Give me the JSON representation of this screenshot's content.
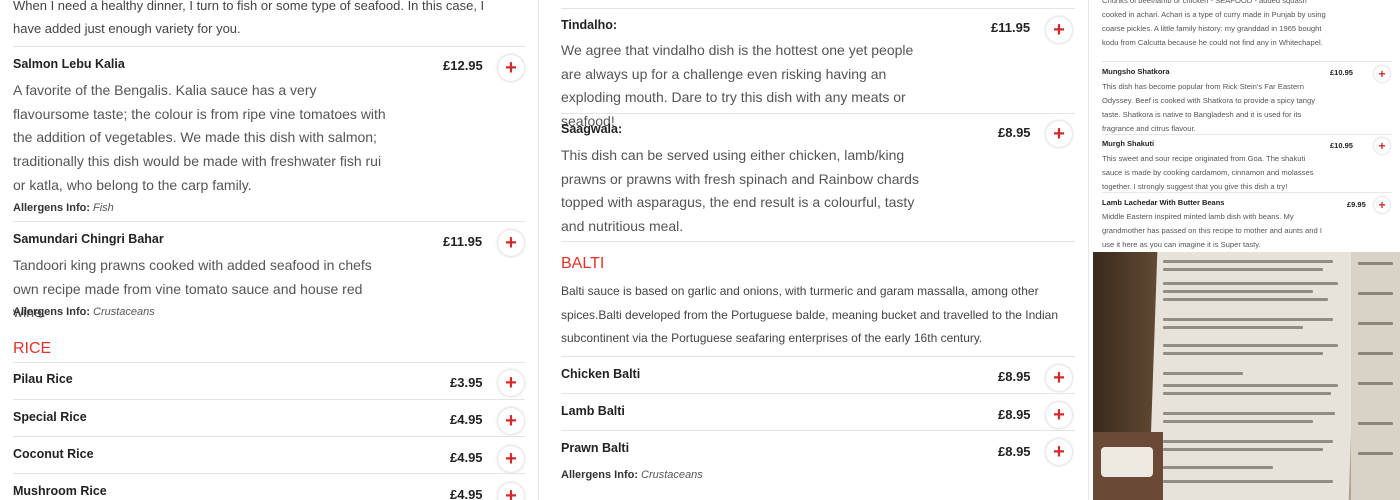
{
  "col1": {
    "intro": "When I need a healthy dinner, I turn to fish or some type of seafood. In this case, I have added just enough variety for you.",
    "items": [
      {
        "name": "Salmon Lebu Kalia",
        "price": "£12.95",
        "desc": "A favorite of the Bengalis. Kalia sauce has a very flavoursome taste; the colour is from ripe vine tomatoes with the addition of vegetables. We made this dish with salmon; traditionally this dish would be made with freshwater fish rui or katla, who belong to the carp family.",
        "allergen_label": "Allergens Info:",
        "allergen": "Fish"
      },
      {
        "name": "Samundari Chingri Bahar",
        "price": "£11.95",
        "desc": "Tandoori king prawns cooked with added seafood in chefs own recipe made from vine tomato sauce and house red wine.",
        "allergen_label": "Allergens Info:",
        "allergen": "Crustaceans"
      }
    ],
    "rice_title": "RICE",
    "rice": [
      {
        "name": "Pilau Rice",
        "price": "£3.95"
      },
      {
        "name": "Special Rice",
        "price": "£4.95"
      },
      {
        "name": "Coconut Rice",
        "price": "£4.95"
      },
      {
        "name": "Mushroom Rice",
        "price": "£4.95"
      }
    ],
    "add_symbol": "+"
  },
  "col2": {
    "items": [
      {
        "name": "Tindalho:",
        "price": "£11.95",
        "desc": "We agree that vindalho dish is the hottest one yet people are always up for a challenge even risking having an exploding mouth. Dare to try this dish with any meats or seafood!"
      },
      {
        "name": "Saagwala:",
        "price": "£8.95",
        "desc": "This dish can be served using either chicken, lamb/king prawns or prawns with fresh spinach and Rainbow chards topped with asparagus, the end result is a colourful, tasty and nutritious meal."
      }
    ],
    "balti_title": "BALTI",
    "balti_desc": "Balti sauce is based on garlic and onions, with turmeric and garam massalla, among other spices.Balti developed from the Portuguese balde, meaning bucket and travelled to the Indian subcontinent via the Portuguese seafaring enterprises of the early 16th century.",
    "balti": [
      {
        "name": "Chicken Balti",
        "price": "£8.95"
      },
      {
        "name": "Lamb Balti",
        "price": "£8.95"
      },
      {
        "name": "Prawn Balti",
        "price": "£8.95"
      }
    ],
    "balti_allergen_label": "Allergens Info:",
    "balti_allergen": "Crustaceans"
  },
  "col3": {
    "top_text": "Chunks of beef/lamb or chicken - SEAFOOD - added squash cooked in achari. Achari is a type of curry made in Punjab by using coarse pickles. A little family history: my granddad in 1965 bought kodu from Calcutta because he could not find any in Whitechapel.",
    "items": [
      {
        "name": "Mungsho Shatkora",
        "price": "£10.95",
        "desc": "This dish has become popular from Rick Stein's Far Eastern Odyssey. Beef is cooked with Shatkora to provide a spicy tangy taste.  Shatkora is native to Bangladesh and it is used for its fragrance and citrus flavour."
      },
      {
        "name": "Murgh Shakuti",
        "price": "£10.95",
        "desc": "This sweet and sour recipe originated from Goa. The shakuti sauce is made by cooking cardamom, cinnamon and molasses together. I strongly suggest that you give this dish a try!"
      },
      {
        "name": "Lamb Lachedar With Butter Beans",
        "price": "£9.95",
        "desc": "Middle Eastern inspired minted lamb dish with beans. My grandmother has passed on this recipe to mother and aunts and I use it here as you can imagine it is Super tasty."
      }
    ]
  },
  "colors": {
    "accent": "#e0332b",
    "divider": "#e3e3e3"
  }
}
